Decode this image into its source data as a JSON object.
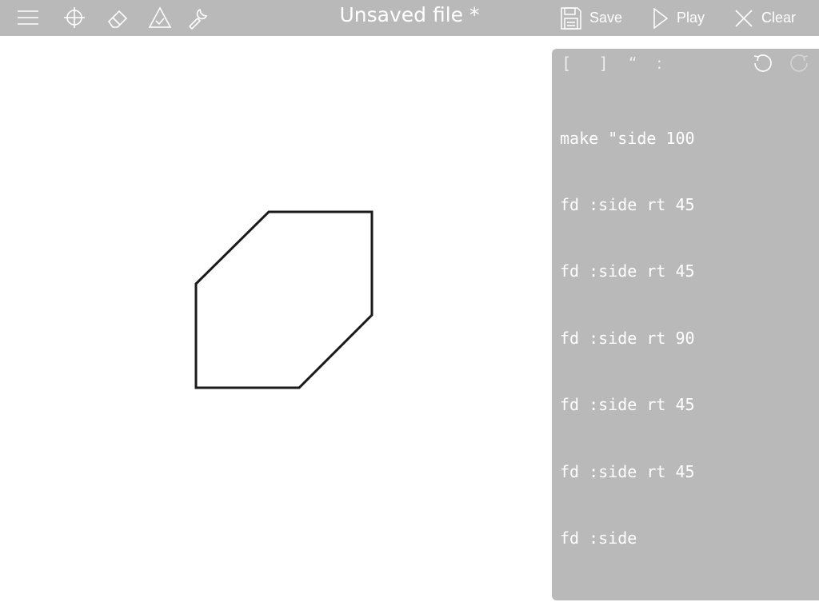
{
  "toolbar": {
    "title": "Unsaved file *",
    "save_label": "Save",
    "play_label": "Play",
    "clear_label": "Clear"
  },
  "editor": {
    "symbols": [
      "[",
      "]",
      "“",
      ":"
    ],
    "lines": [
      "make \"side 100",
      "fd :side rt 45",
      "fd :side rt 45",
      "fd :side rt 90",
      "fd :side rt 45",
      "fd :side rt 45",
      "fd :side"
    ]
  },
  "colors": {
    "toolbar_bg": "#b9b9b9",
    "editor_bg": "#b9b9b9",
    "drawing_stroke": "#1a1a1a"
  },
  "icons": [
    "menu-icon",
    "crosshair-icon",
    "eraser-icon",
    "triangle-turtle-icon",
    "wrench-icon",
    "save-icon",
    "play-icon",
    "clear-icon",
    "undo-icon",
    "redo-icon"
  ]
}
